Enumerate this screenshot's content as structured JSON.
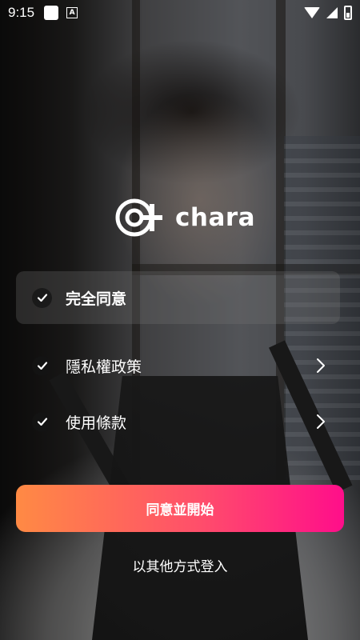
{
  "status_bar": {
    "time": "9:15"
  },
  "brand": {
    "name": "chara"
  },
  "consent": {
    "agree_all": "完全同意",
    "items": [
      {
        "label": "隱私權政策"
      },
      {
        "label": "使用條款"
      }
    ]
  },
  "actions": {
    "start": "同意並開始",
    "other_login": "以其他方式登入"
  },
  "colors": {
    "button_gradient_start": "#ff8a44",
    "button_gradient_end": "#ff0e8a"
  }
}
